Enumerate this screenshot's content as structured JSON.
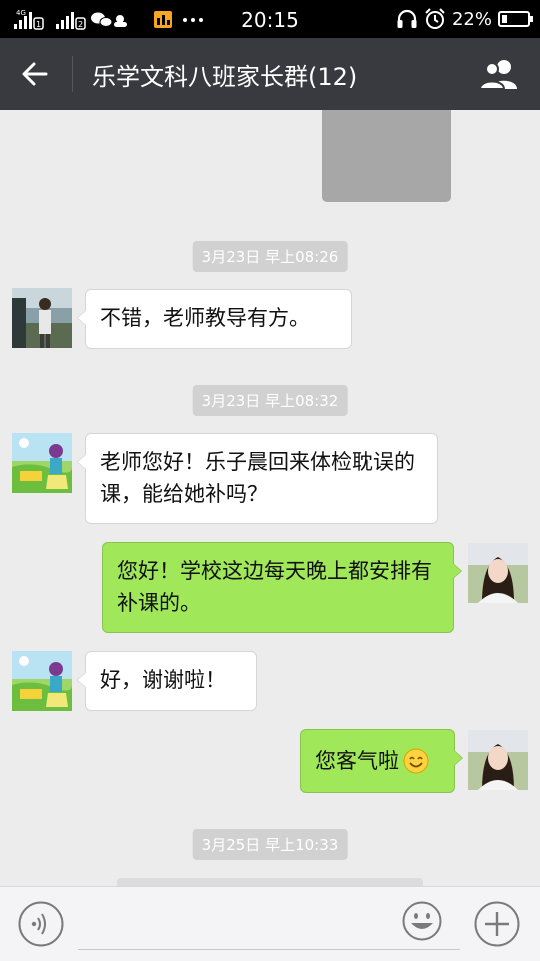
{
  "status_bar": {
    "network_label": "4G",
    "sim1_badge": "1",
    "sim2_badge": "2",
    "time": "20:15",
    "battery_text": "22%",
    "battery_level": 0.22,
    "icons": [
      "signal-icon",
      "wechat-icon",
      "weather-icon",
      "app-icon",
      "more-dots-icon",
      "headphones-icon",
      "alarm-icon",
      "battery-icon"
    ]
  },
  "nav": {
    "title": "乐学文科八班家长群(12)",
    "back_icon": "back-arrow-icon",
    "members_icon": "group-members-icon"
  },
  "messages": [
    {
      "type": "timestamp",
      "text": "3月23日 早上08:26"
    },
    {
      "type": "incoming",
      "text": "不错，老师教导有方。"
    },
    {
      "type": "timestamp",
      "text": "3月23日 早上08:32"
    },
    {
      "type": "incoming",
      "text": "老师您好！乐子晨回来体检耽误的课，能给她补吗？"
    },
    {
      "type": "outgoing",
      "text": "您好！学校这边每天晚上都安排有补课的。"
    },
    {
      "type": "incoming",
      "text": "好，谢谢啦！"
    },
    {
      "type": "outgoing",
      "text": "您客气啦",
      "emoji": "smile-emoji"
    },
    {
      "type": "timestamp",
      "text": "3月25日 早上10:33"
    }
  ],
  "input_bar": {
    "placeholder": "",
    "icons": [
      "voice-icon",
      "emoji-icon",
      "plus-icon"
    ]
  },
  "colors": {
    "nav_bg": "#393a3f",
    "chat_bg": "#ececec",
    "outgoing_bubble": "#a0e75a",
    "incoming_bubble": "#ffffff",
    "timestamp_bg": "#d1d1d1"
  }
}
